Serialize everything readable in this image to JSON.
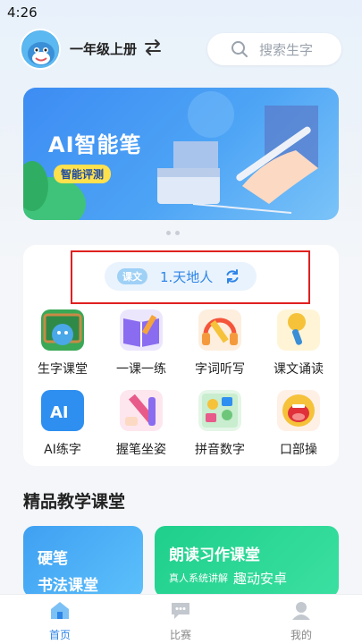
{
  "status_bar": {
    "time": "4:26"
  },
  "header": {
    "grade": "一年级上册",
    "search_placeholder": "搜索生字"
  },
  "banner": {
    "title": "AI智能笔",
    "badge": "智能评测"
  },
  "lesson": {
    "tag": "课文",
    "name": "1.天地人"
  },
  "features": [
    {
      "label": "生字课堂",
      "icon": "chalkboard-dolphin-icon",
      "color": "#3aa856"
    },
    {
      "label": "一课一练",
      "icon": "open-book-icon",
      "color": "#8a6cf0"
    },
    {
      "label": "字词听写",
      "icon": "headphones-pencil-icon",
      "color": "#f59a3c"
    },
    {
      "label": "课文诵读",
      "icon": "microphone-icon",
      "color": "#f5c23a"
    },
    {
      "label": "AI练字",
      "icon": "ai-board-icon",
      "color": "#2e8ff0"
    },
    {
      "label": "握笔坐姿",
      "icon": "pencil-icon",
      "color": "#e85a8a"
    },
    {
      "label": "拼音数字",
      "icon": "pinyin-cards-icon",
      "color": "#6ec67a"
    },
    {
      "label": "口部操",
      "icon": "mouth-icon",
      "color": "#f5553a"
    }
  ],
  "section": {
    "title": "精品教学课堂"
  },
  "courses": {
    "card1_line1": "硬笔",
    "card1_line2": "书法课堂",
    "card2_title": "朗读习作课堂",
    "card2_sub": "真人系统讲解",
    "card2_sub2": "趣动安卓"
  },
  "tabbar": [
    {
      "label": "首页",
      "icon": "home-icon",
      "active": true
    },
    {
      "label": "比赛",
      "icon": "chat-bubble-icon",
      "active": false
    },
    {
      "label": "我的",
      "icon": "profile-icon",
      "active": false
    }
  ],
  "colors": {
    "accent": "#2e85e8",
    "highlight_border": "#e02020"
  }
}
